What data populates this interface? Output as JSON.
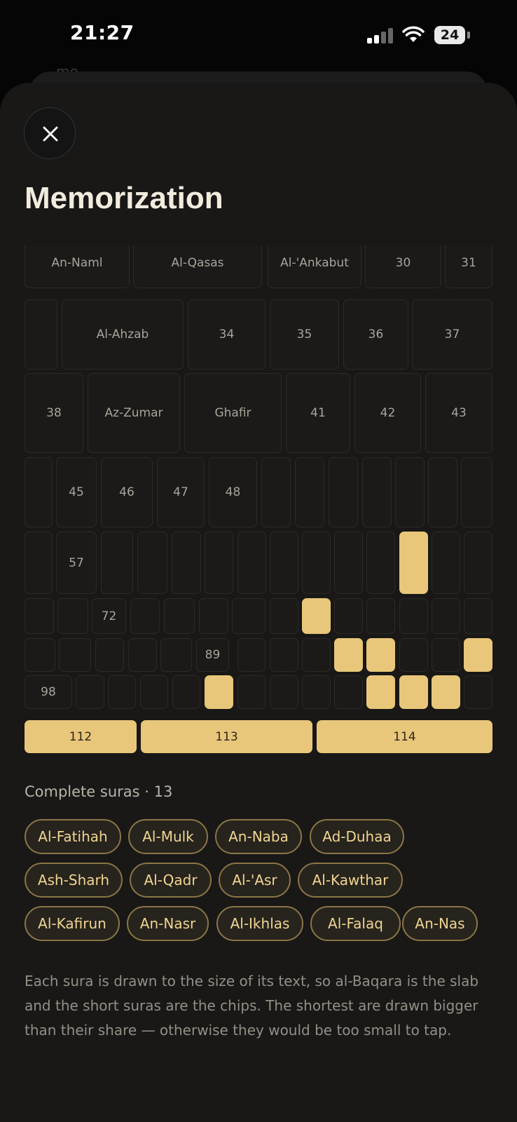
{
  "status": {
    "time": "21:27",
    "battery": "24"
  },
  "background_text": "me.",
  "title": "Memorization",
  "icons": {
    "close": "close-icon",
    "signal": "cellular-signal-icon",
    "wifi": "wifi-icon",
    "battery": "battery-icon"
  },
  "colors": {
    "memorized": "#e8c77a",
    "accent_text": "#f0d592",
    "background": "#191817"
  },
  "grid": [
    "An-Naml",
    "Al-Qasas",
    "Al-'Ankabut",
    "30",
    "31",
    "",
    "Al-Ahzab",
    "34",
    "35",
    "36",
    "37",
    "38",
    "Az-Zumar",
    "Ghafir",
    "41",
    "42",
    "43",
    "",
    "45",
    "46",
    "47",
    "48",
    "",
    "",
    "",
    "",
    "",
    "",
    "",
    "",
    "57",
    "",
    "",
    "",
    "",
    "",
    "",
    "",
    "",
    "",
    "",
    "",
    "",
    "",
    "",
    "72",
    "",
    "",
    "",
    "",
    "",
    "",
    "",
    "",
    "",
    "",
    "",
    "",
    "",
    "",
    "",
    "",
    "89",
    "",
    "",
    "",
    "",
    "",
    "",
    "",
    "",
    "98",
    "",
    "",
    "",
    "",
    "",
    "",
    "",
    "",
    "",
    "",
    "",
    "",
    "",
    "112",
    "113",
    "114"
  ],
  "memorized_sura_numbers": [
    67,
    78,
    93,
    94,
    97,
    103,
    108,
    109,
    110,
    112,
    113,
    114
  ],
  "complete": {
    "label": "Complete suras · 13",
    "suras": [
      "Al-Fatihah",
      "Al-Mulk",
      "An-Naba",
      "Ad-Duhaa",
      "Ash-Sharh",
      "Al-Qadr",
      "Al-'Asr",
      "Al-Kawthar",
      "Al-Kafirun",
      "An-Nasr",
      "Al-Ikhlas",
      "Al-Falaq",
      "An-Nas"
    ]
  },
  "note": "Each sura is drawn to the size of its text, so al-Baqara is the slab and the short suras are the chips. The shortest are drawn bigger than their share — otherwise they would be too small to tap."
}
